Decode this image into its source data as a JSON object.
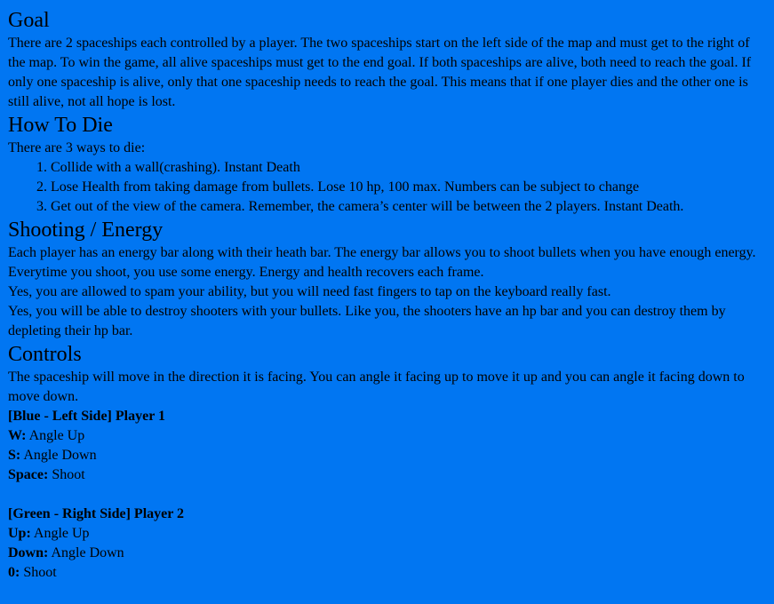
{
  "goal": {
    "heading": "Goal",
    "text": "There are 2 spaceships each controlled by a player. The two spaceships start on the left side of the map and must get to the right of the map. To win the game, all alive spaceships must get to the end goal. If both spaceships are alive, both need to reach the goal. If only one spaceship is alive, only that one spaceship needs to reach the goal. This means that if one player dies and the other one is still alive, not all hope is lost."
  },
  "how_to_die": {
    "heading": "How To Die",
    "intro": "There are 3 ways to die:",
    "items": [
      "Collide with a wall(crashing). Instant Death",
      "Lose Health from taking damage from bullets. Lose 10 hp, 100 max. Numbers can be subject to change",
      "Get out of the view of the camera. Remember, the camera’s center will be between the 2 players. Instant Death."
    ]
  },
  "shooting": {
    "heading": "Shooting / Energy",
    "p1": "Each player has an energy bar along with their heath bar. The energy bar allows you to shoot bullets when you have enough energy. Everytime you shoot, you use some energy. Energy and health recovers each frame.",
    "p2": "Yes, you are allowed to spam your ability, but you will need fast fingers to tap on the keyboard really fast.",
    "p3": "Yes, you will be able to destroy shooters with your bullets. Like you, the shooters have an hp bar and you can destroy them by depleting their hp bar."
  },
  "controls": {
    "heading": "Controls",
    "intro": "The spaceship will move in the direction it is facing. You can angle it facing up to move it up and you can angle it facing down to move down.",
    "player1": {
      "title": "[Blue - Left Side] Player 1",
      "keys": [
        {
          "key": "W:",
          "action": " Angle Up"
        },
        {
          "key": "S:",
          "action": " Angle Down"
        },
        {
          "key": "Space:",
          "action": " Shoot"
        }
      ]
    },
    "player2": {
      "title": "[Green - Right Side] Player 2",
      "keys": [
        {
          "key": "Up:",
          "action": " Angle Up"
        },
        {
          "key": "Down:",
          "action": " Angle Down"
        },
        {
          "key": "0:",
          "action": " Shoot"
        }
      ]
    }
  },
  "colors": {
    "background": "#0176f2",
    "text": "#000000"
  }
}
